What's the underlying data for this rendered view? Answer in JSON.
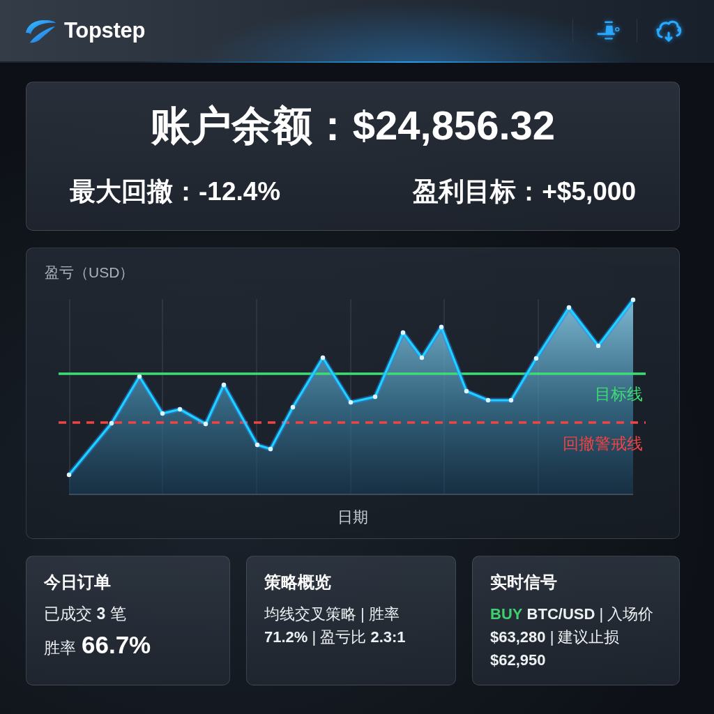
{
  "header": {
    "brand": "Topstep"
  },
  "summary": {
    "balance": "账户余额：$24,856.32",
    "stats": [
      "最大回撤：-12.4%",
      "盈利目标：+$5,000"
    ]
  },
  "chart": {
    "title": "盈亏（USD）",
    "xlabel": "日期",
    "lines": [
      {
        "kind": "target",
        "label": "目标线"
      },
      {
        "kind": "drawdown",
        "label": "回撤警戒线"
      }
    ]
  },
  "cards": [
    {
      "kind": "orders",
      "title": "今日订单",
      "filled": "已成交 **3** 笔",
      "win_label": "胜率",
      "win_value": "66.7%"
    },
    {
      "kind": "strategy",
      "title": "策略概览",
      "text": "均线交叉策略 | 胜率 **71.2%** | 盈亏比 **2.3:1**"
    },
    {
      "kind": "signal",
      "title": "实时信号",
      "action": {
        "kind": "buy",
        "label": "BUY"
      },
      "text": "**BTC/USD** | 入场价 **$63,280** | 建议止损 **$62,950**"
    }
  ]
}
